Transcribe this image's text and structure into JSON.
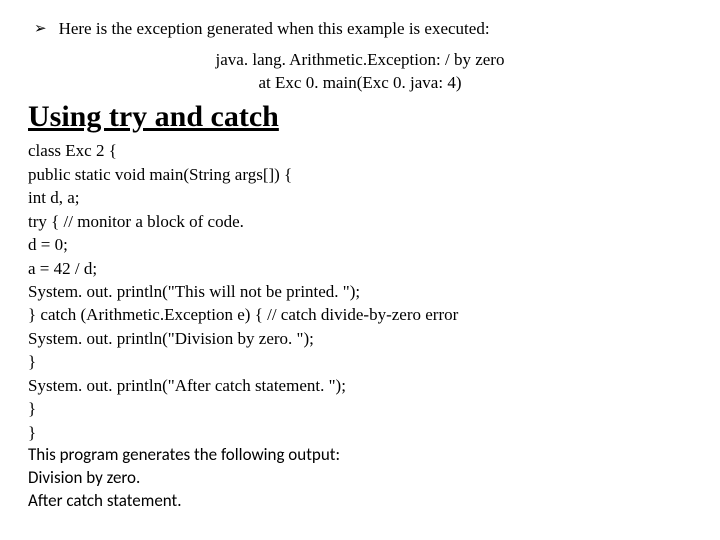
{
  "bullet": {
    "glyph": "➢",
    "text": "Here is the exception generated when this example is executed:"
  },
  "exception": {
    "line1": "java. lang. Arithmetic.Exception: / by zero",
    "line2": "at Exc 0. main(Exc 0. java: 4)"
  },
  "heading": "Using try and catch",
  "code": {
    "l0": "class Exc 2 {",
    "l1": "public static void main(String args[]) {",
    "l2": "int d, a;",
    "l3": "try { // monitor a block of code.",
    "l4": "d = 0;",
    "l5": "a = 42 / d;",
    "l6": "System. out. println(\"This will not be printed. \");",
    "l7": "} catch (Arithmetic.Exception e) { // catch divide-by-zero error",
    "l8": "System. out. println(\"Division by zero. \");",
    "l9": "}",
    "l10": "System. out. println(\"After catch statement. \");",
    "l11": "}",
    "l12": "}"
  },
  "outnote": {
    "l0": "This program generates the following output:",
    "l1": "Division by zero.",
    "l2": "After catch statement."
  }
}
